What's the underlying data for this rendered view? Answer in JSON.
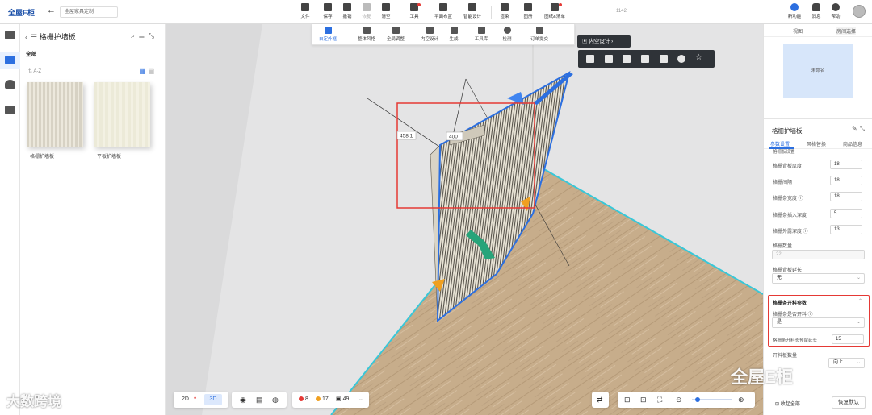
{
  "app": {
    "logo": "全屋E柜",
    "scheme_name": "全屋家具定制"
  },
  "toolbar": {
    "items": [
      {
        "label": "文件",
        "icon": "file-icon"
      },
      {
        "label": "保存",
        "icon": "save-icon"
      },
      {
        "label": "撤销",
        "icon": "undo-icon"
      },
      {
        "label": "恢复",
        "icon": "redo-icon"
      },
      {
        "label": "清空",
        "icon": "eraser-icon"
      },
      {
        "label": "工具",
        "icon": "tool-icon"
      },
      {
        "label": "平面布置",
        "icon": "floorplan-icon"
      },
      {
        "label": "智能设计",
        "icon": "smart-design-icon"
      },
      {
        "label": "渲染",
        "icon": "render-icon"
      },
      {
        "label": "图册",
        "icon": "album-icon"
      },
      {
        "label": "图纸&清单",
        "icon": "drawings-icon"
      }
    ],
    "right": [
      {
        "label": "新功能",
        "icon": "new-feature-icon"
      },
      {
        "label": "消息",
        "icon": "bell-icon"
      },
      {
        "label": "帮助",
        "icon": "help-icon"
      }
    ],
    "coord_hint": "1142"
  },
  "left_panel": {
    "title": "格栅护墙板",
    "all_label": "全部",
    "sort_label": "A-Z",
    "products": [
      {
        "name": "格栅护墙板"
      },
      {
        "name": "平板护墙板"
      }
    ]
  },
  "sub_toolbar": {
    "items": [
      {
        "label": "自定外框",
        "active": true
      },
      {
        "label": "整体风格",
        "active": false
      },
      {
        "label": "全局调整",
        "active": false
      },
      {
        "label": "内空设计",
        "active": false
      },
      {
        "label": "生成",
        "active": false
      },
      {
        "label": "工具库",
        "active": false
      },
      {
        "label": "检测",
        "active": false
      },
      {
        "label": "订单提交",
        "active": false
      }
    ]
  },
  "context": {
    "button_label": "内空设计"
  },
  "dimensions": {
    "width": "400",
    "height": "458.1"
  },
  "bottom": {
    "mode_2d": "2D",
    "mode_3d": "3D",
    "errors": "8",
    "warnings": "17",
    "items": "49"
  },
  "right_panel": {
    "tabs": [
      "视图",
      "房间选择"
    ],
    "room_label": "未命名",
    "title": "格栅护墙板",
    "subtabs": [
      "参数设置",
      "风格替换",
      "商品信息"
    ],
    "section_cut": "格栅板设置",
    "params": [
      {
        "label": "格栅背板厚度",
        "value": "18"
      },
      {
        "label": "格栅间隔",
        "value": "18"
      },
      {
        "label": "格栅条宽度 ⓘ",
        "value": "18"
      },
      {
        "label": "格栅条插入深度",
        "value": "5"
      },
      {
        "label": "格栅外露深度 ⓘ",
        "value": "13"
      }
    ],
    "count_label": "格栅数量",
    "count_value": "22",
    "back_extend_label": "格栅背板延长",
    "back_extend_value": "无",
    "group": {
      "title": "格栅条开料参数",
      "slot_label": "格栅条是否开料 ⓘ",
      "slot_value": "是",
      "reserve_label": "格栅条开料长预留延长",
      "reserve_value": "15"
    },
    "next_label": "开料板数量",
    "next_value": "向上",
    "collapse_all": "收起全部",
    "restore_default": "恢复默认"
  },
  "watermarks": {
    "left": "大数跨境",
    "right": "全屋E柜"
  },
  "colors": {
    "accent": "#2c6fe0",
    "highlight": "#e53935",
    "floor": "#c9b08f"
  }
}
